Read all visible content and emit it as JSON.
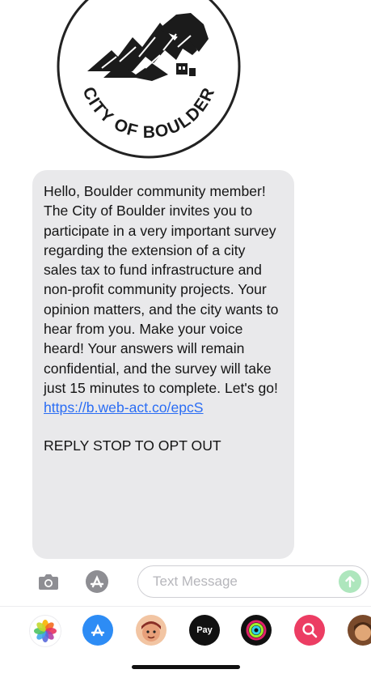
{
  "logo": {
    "text": "CITY OF BOULDER"
  },
  "message": {
    "body": "Hello, Boulder community member! The City of Boulder invites you to participate in a very important survey regarding the extension of a city sales tax to fund infrastructure and non-profit community projects. Your opinion matters, and the city wants to hear from you. Make your voice heard! Your answers will remain confidential, and the survey will take just 15 minutes to complete. Let's go! ",
    "link": "https://b.web-act.co/epcS",
    "opt_out": "REPLY STOP TO OPT OUT"
  },
  "input": {
    "placeholder": "Text Message"
  },
  "apps": [
    {
      "name": "photos-icon"
    },
    {
      "name": "app-store-icon"
    },
    {
      "name": "memoji-icon"
    },
    {
      "name": "apple-pay-icon",
      "label": "Pay"
    },
    {
      "name": "fitness-icon"
    },
    {
      "name": "image-search-icon"
    },
    {
      "name": "avatar-icon"
    }
  ],
  "colors": {
    "bubble": "#e9e9eb",
    "link": "#2a6df4",
    "send": "#aee6bd"
  }
}
